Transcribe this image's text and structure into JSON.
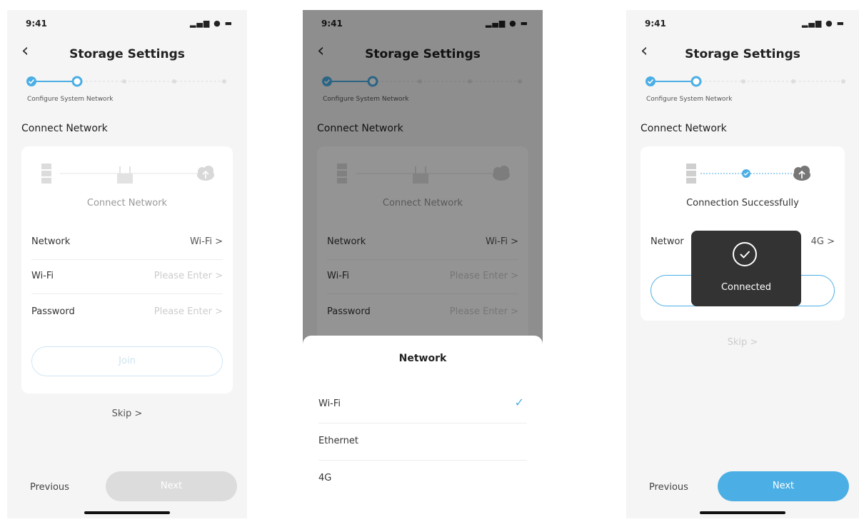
{
  "status": {
    "time": "9:41",
    "signal": "▂▄▆ ● ▬"
  },
  "header": {
    "back": "‹",
    "title": "Storage Settings"
  },
  "steps": {
    "label": "Configure System Network",
    "total": 5,
    "current": 2
  },
  "section_title": "Connect Network",
  "card": {
    "connect_text": "Connect Network",
    "success_text": "Connection Successfully",
    "rows": [
      {
        "label": "Network",
        "value": "Wi-Fi >"
      },
      {
        "label": "Wi-Fi",
        "value": "Please Enter >"
      },
      {
        "label": "Password",
        "value": "Please Enter >"
      }
    ],
    "join": "Join",
    "network_label_truncated": "Networ",
    "network_value_4g": "4G >"
  },
  "skip": "Skip >",
  "footer": {
    "previous": "Previous",
    "next": "Next"
  },
  "sheet": {
    "title": "Network",
    "options": [
      {
        "label": "Wi-Fi",
        "selected": true
      },
      {
        "label": "Ethernet",
        "selected": false
      },
      {
        "label": "4G",
        "selected": false
      }
    ],
    "check": "✓"
  },
  "toast": {
    "text": "Connected"
  },
  "colors": {
    "accent": "#4baee5",
    "disabled": "#dcdcdc",
    "toast_bg": "#333333"
  }
}
